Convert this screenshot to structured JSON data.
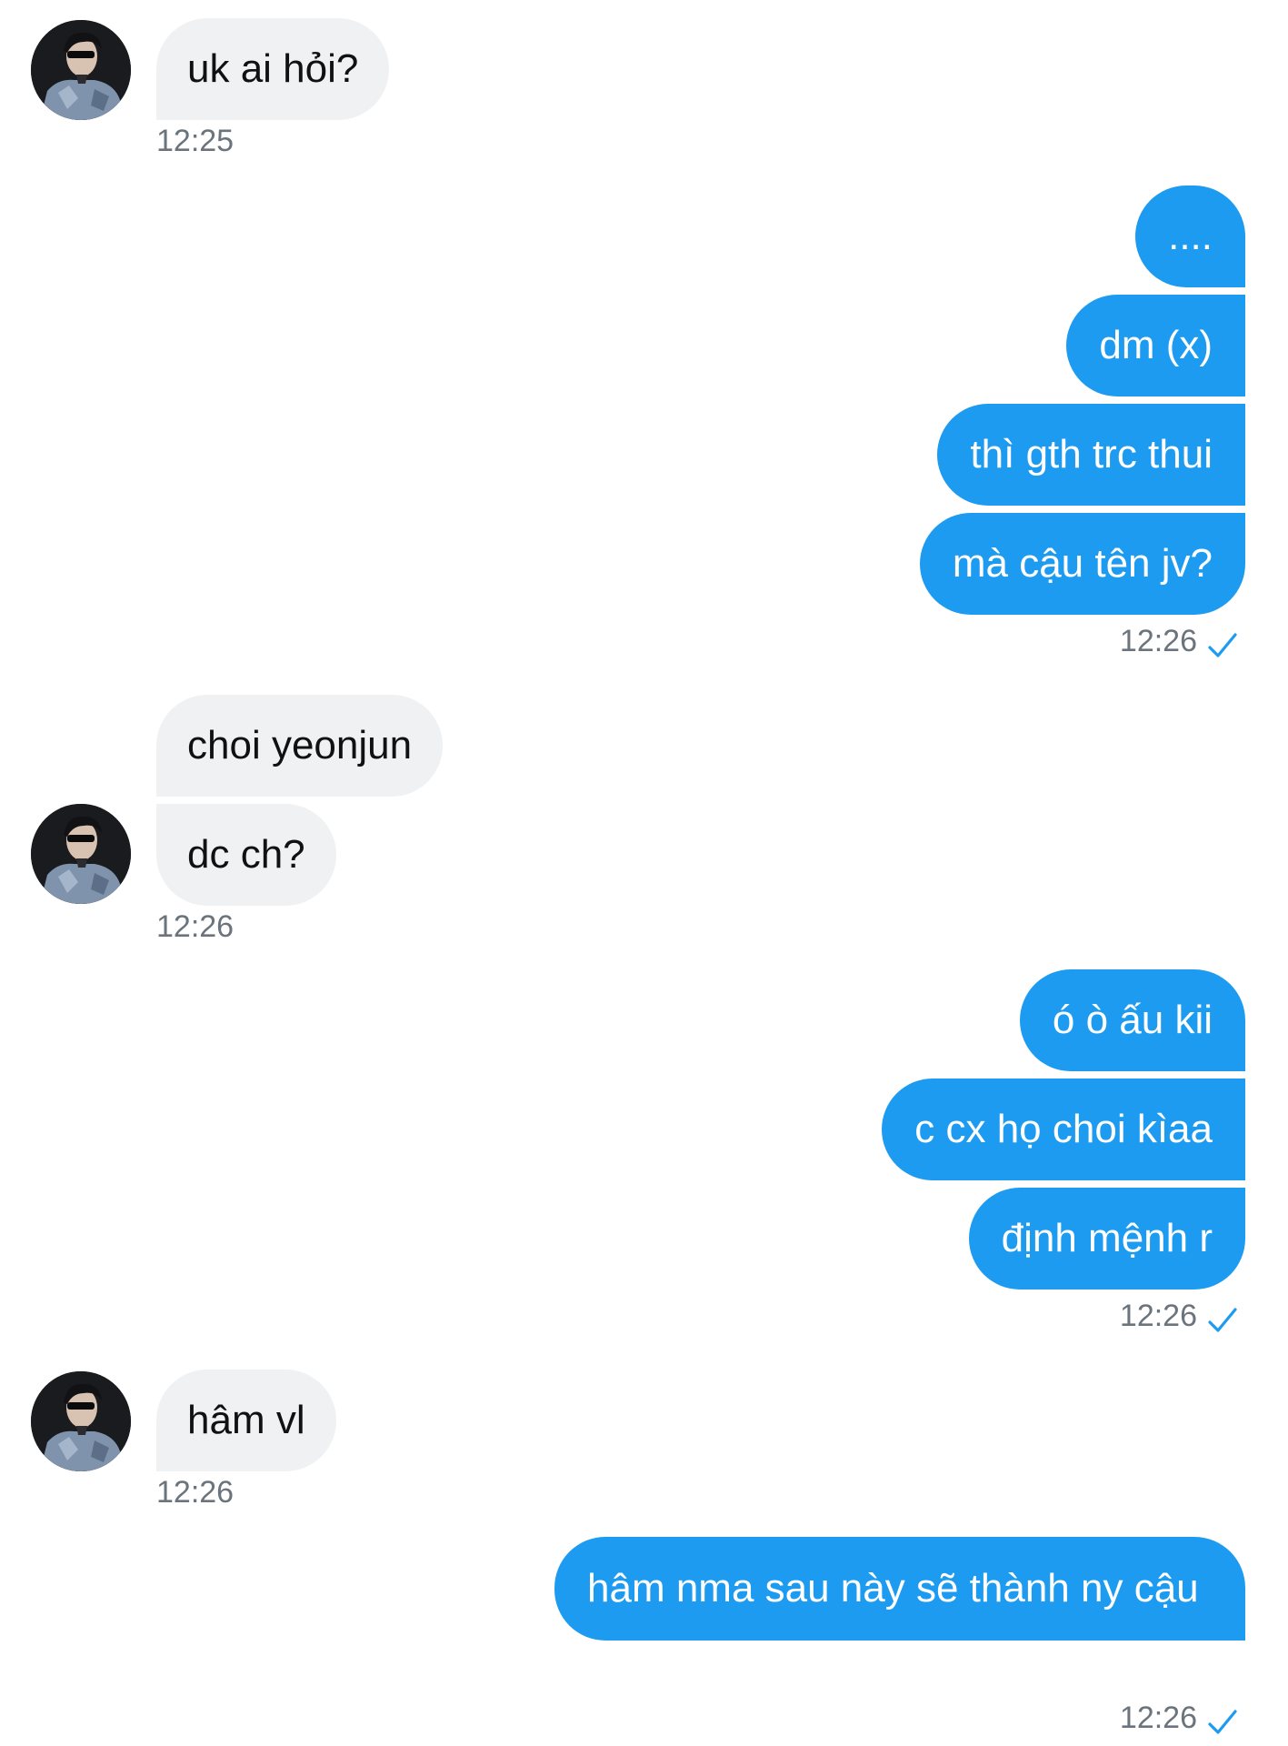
{
  "messages": [
    {
      "side": "in",
      "text": "uk ai hỏi?"
    },
    {
      "side": "in_time",
      "text": "12:25"
    },
    {
      "side": "out",
      "text": "...."
    },
    {
      "side": "out",
      "text": "dm (x)"
    },
    {
      "side": "out",
      "text": "thì gth trc thui"
    },
    {
      "side": "out",
      "text": "mà cậu tên jv?"
    },
    {
      "side": "out_time",
      "text": "12:26"
    },
    {
      "side": "in",
      "text": "choi yeonjun"
    },
    {
      "side": "in",
      "text": "dc ch?"
    },
    {
      "side": "in_time",
      "text": "12:26"
    },
    {
      "side": "out",
      "text": "ó ò ấu kii"
    },
    {
      "side": "out",
      "text": "c cx họ choi kìaa"
    },
    {
      "side": "out",
      "text": "định mệnh r"
    },
    {
      "side": "out_time",
      "text": "12:26"
    },
    {
      "side": "in",
      "text": "hâm vl"
    },
    {
      "side": "in_time",
      "text": "12:26"
    },
    {
      "side": "out",
      "text": "hâm nma sau này sẽ thành ny cậu"
    },
    {
      "side": "out_time",
      "text": "12:26"
    }
  ],
  "colors": {
    "outgoing_bubble": "#1d9bf0",
    "incoming_bubble": "#eff1f3",
    "timestamp": "#6b747c",
    "read_check": "#1d9bf0"
  },
  "icons": {
    "avatar": "profile-photo",
    "read_receipt": "check-icon"
  }
}
